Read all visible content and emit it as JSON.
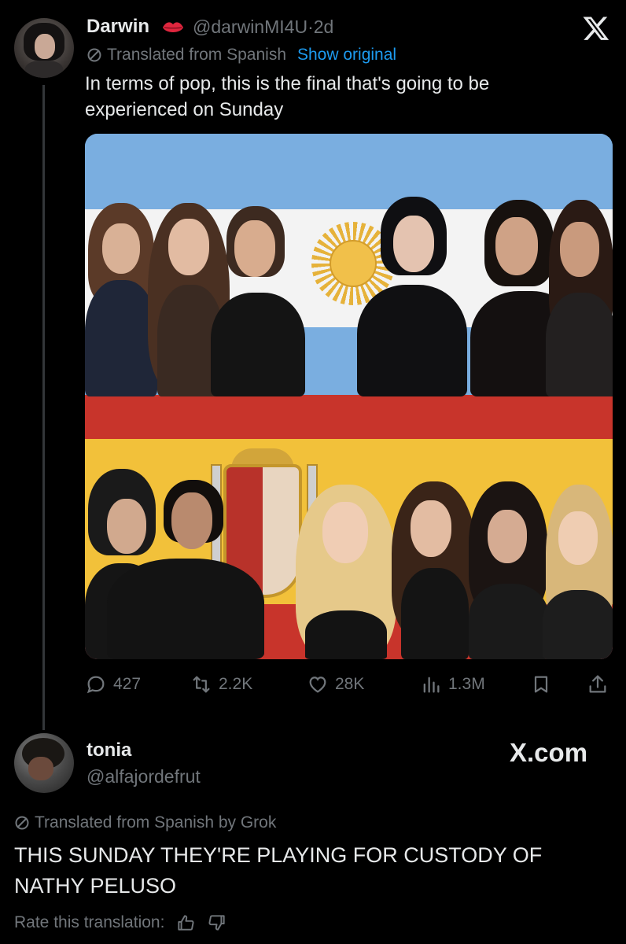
{
  "tweet": {
    "author_name": "Darwin",
    "author_handle": "@darwinMI4U",
    "separator": "·",
    "time_ago": "2d",
    "translated_label": "Translated from Spanish",
    "show_original_label": "Show original",
    "text": "In terms of pop, this is the final that's going to be experienced on Sunday",
    "metrics": {
      "replies": "427",
      "reposts": "2.2K",
      "likes": "28K",
      "views": "1.3M"
    }
  },
  "reply": {
    "author_name": "tonia",
    "author_handle": "@alfajordefrut",
    "watermark": "X.com",
    "translated_label": "Translated from Spanish by Grok",
    "text": "THIS SUNDAY THEY'RE PLAYING FOR CUSTODY OF NATHY PELUSO",
    "rate_label": "Rate this translation:"
  },
  "colors": {
    "background": "#000000",
    "text_primary": "#e7e9ea",
    "text_secondary": "#71767b",
    "link": "#1d9bf0",
    "thread_line": "#333639"
  },
  "icons": [
    "x-logo-icon",
    "lips-emoji-icon",
    "translate-icon",
    "reply-icon",
    "repost-icon",
    "like-icon",
    "views-icon",
    "bookmark-icon",
    "share-icon",
    "thumbs-up-icon",
    "thumbs-down-icon"
  ]
}
